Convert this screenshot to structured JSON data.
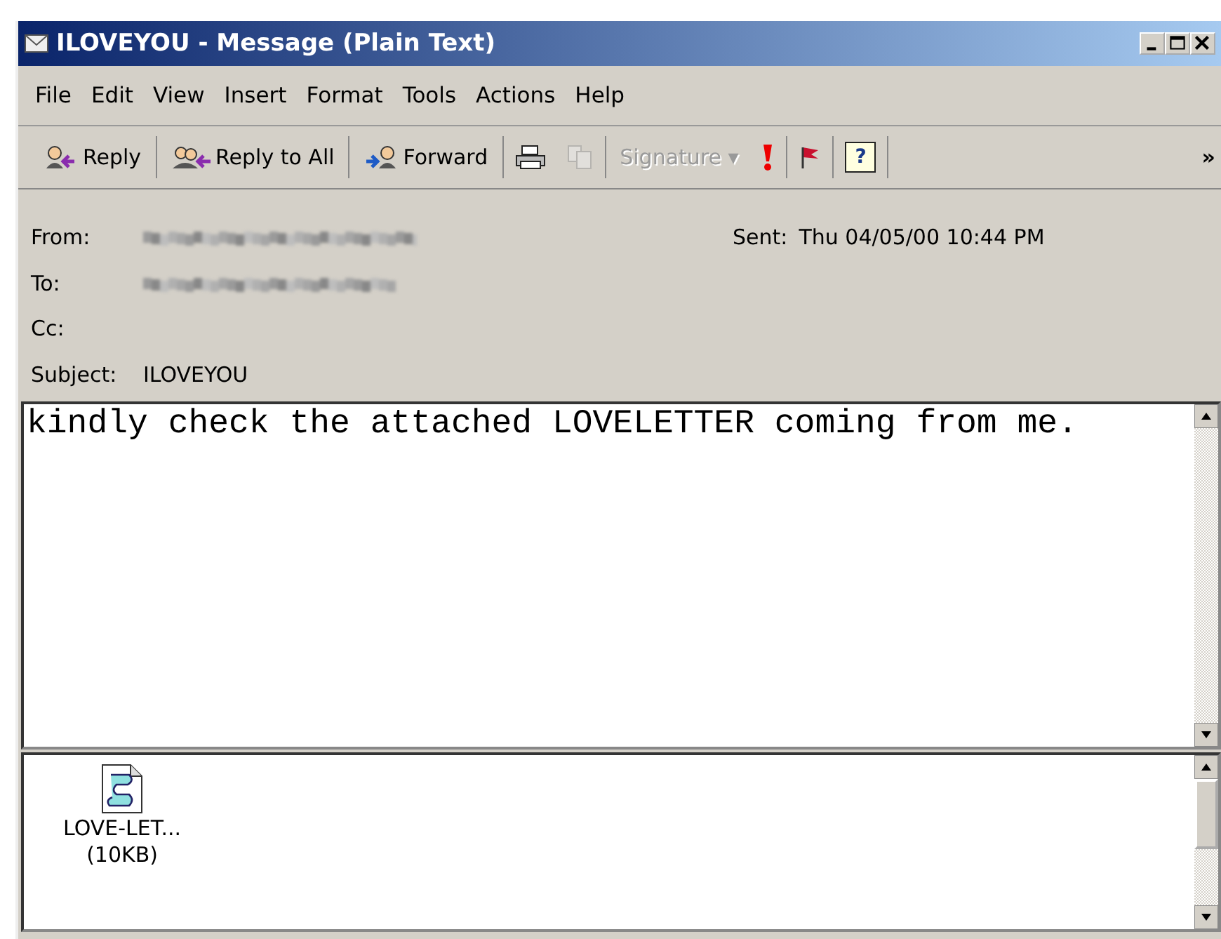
{
  "window": {
    "title": "ILOVEYOU - Message (Plain Text)"
  },
  "menu": [
    "File",
    "Edit",
    "View",
    "Insert",
    "Format",
    "Tools",
    "Actions",
    "Help"
  ],
  "toolbar": [
    [
      {
        "kind": "reply",
        "label": "Reply",
        "disabled": false
      }
    ],
    [
      {
        "kind": "reply-all",
        "label": "Reply to All",
        "disabled": false
      }
    ],
    [
      {
        "kind": "forward",
        "label": "Forward",
        "disabled": false
      }
    ],
    [
      {
        "kind": "print",
        "disabled": false
      },
      {
        "kind": "copy",
        "disabled": true
      }
    ],
    [
      {
        "kind": "signature",
        "label": "Signature",
        "caret": "▾",
        "disabled": true
      },
      {
        "kind": "importance",
        "disabled": false
      }
    ],
    [
      {
        "kind": "flag",
        "disabled": false
      }
    ],
    [
      {
        "kind": "help",
        "glyph": "?",
        "disabled": false
      }
    ]
  ],
  "toolbar_overflow": "»",
  "header": {
    "fields": [
      {
        "label": "From:",
        "redacted": true
      },
      {
        "label": "To:",
        "redacted": true
      },
      {
        "label": "Cc:",
        "redacted": false
      },
      {
        "label": "Subject:",
        "value": "ILOVEYOU",
        "redacted": false
      }
    ],
    "sent_label": "Sent:",
    "sent_value": "Thu 04/05/00 10:44 PM"
  },
  "body": "kindly check the attached LOVELETTER coming from me.",
  "attachments": [
    {
      "name": "LOVE-LET...",
      "size": "(10KB)"
    }
  ]
}
